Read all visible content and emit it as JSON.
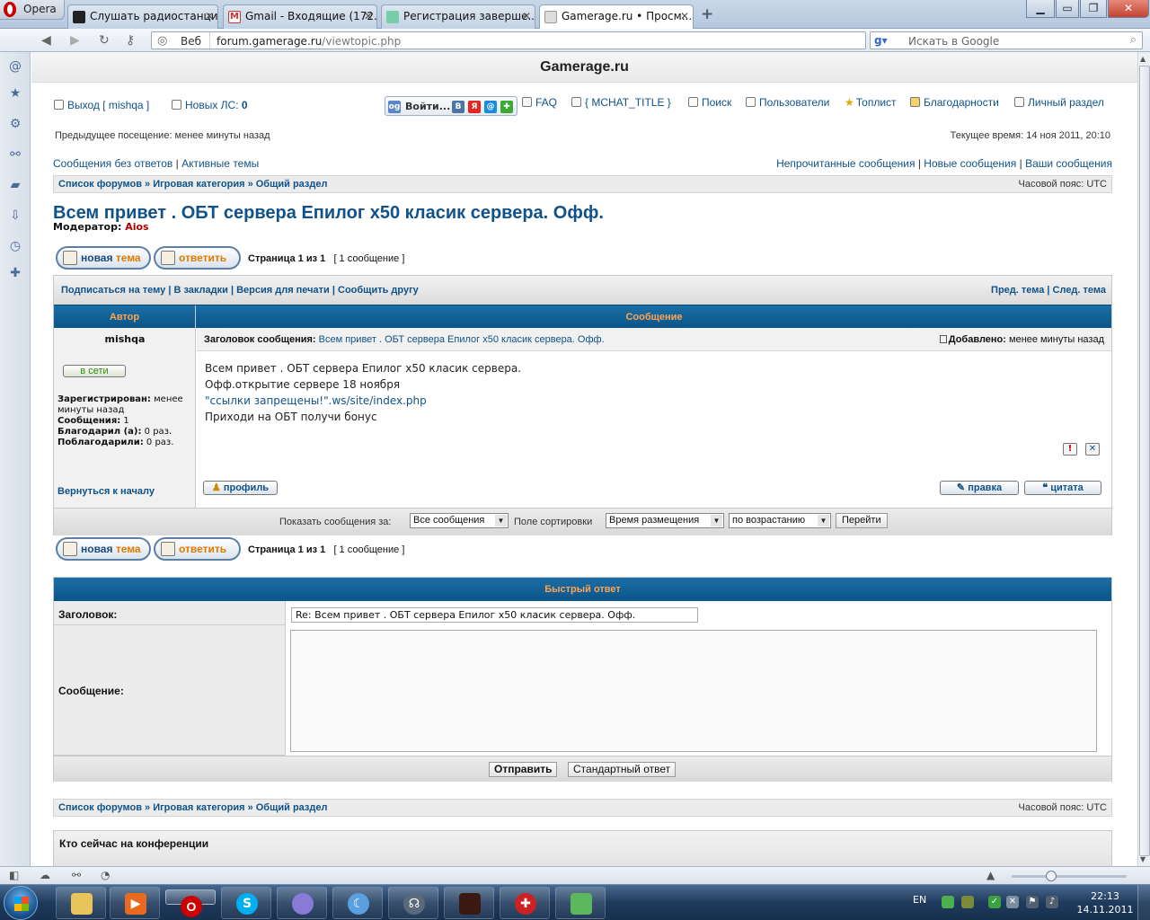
{
  "browser": {
    "opera_label": "Opera",
    "tabs": [
      {
        "label": "Слушать радиостанци..."
      },
      {
        "label": "Gmail - Входящие (172..."
      },
      {
        "label": "Регистрация заверше..."
      },
      {
        "label": "Gamerage.ru • Просм..."
      }
    ],
    "address": {
      "web_label": "Веб",
      "url_host": "forum.gamerage.ru",
      "url_path": "/viewtopic.php"
    },
    "search_placeholder": "Искать в Google"
  },
  "site": {
    "title": "Gamerage.ru"
  },
  "topbar": {
    "logout": "Выход [ mishqa ]",
    "new_pm_label": "Новых ЛС:",
    "new_pm_count": "0",
    "login_box": "Войти...",
    "faq": "FAQ",
    "mchat": "{ MCHAT_TITLE }",
    "search": "Поиск",
    "members": "Пользователи",
    "toplist": "Топлист",
    "thanks": "Благодарности",
    "personal": "Личный раздел",
    "last_visit": "Предыдущее посещение: менее минуты назад",
    "current_time": "Текущее время: 14 ноя 2011, 20:10"
  },
  "links_left": {
    "unanswered": "Сообщения без ответов",
    "sep": "|",
    "active": "Активные темы"
  },
  "links_right": {
    "unread": "Непрочитанные сообщения",
    "new": "Новые сообщения",
    "yours": "Ваши сообщения",
    "sep": "|"
  },
  "breadcrumb": {
    "text": "Список форумов » Игровая категория » Общий раздел",
    "timezone": "Часовой пояс: UTC"
  },
  "topic": {
    "title": "Всем привет . ОБТ сервера Епилог x50 класик сервера. Офф.",
    "moderator_label": "Модератор:",
    "moderator_name": "Aios"
  },
  "buttons": {
    "new_topic_a": "новая ",
    "new_topic_b": "тема",
    "reply": "ответить",
    "page_label": "Страница",
    "page_cur": "1",
    "page_of": "из",
    "page_total": "1",
    "post_count": "[ 1 сообщение ]"
  },
  "options": {
    "left": "Подписаться на тему | В закладки | Версия для печати | Сообщить другу",
    "right": "Пред. тема | След. тема"
  },
  "post_table": {
    "col_author": "Автор",
    "col_message": "Сообщение",
    "author": "mishqa",
    "online": "в сети",
    "registered_label": "Зарегистрирован:",
    "registered_value": "менее минуты назад",
    "posts_label": "Сообщения:",
    "posts_value": "1",
    "thanked_label": "Благодарил (а):",
    "thanked_value": "0 раз.",
    "got_thanks_label": "Поблагодарили:",
    "got_thanks_value": "0 раз.",
    "subject_label": "Заголовок сообщения:",
    "subject_value": "Всем привет . ОБТ сервера Епилог x50 класик сервера. Офф.",
    "added_label": "Добавлено:",
    "added_value": "менее минуты назад",
    "body_line1": "Всем привет . ОБТ сервера Епилог x50 класик сервера.",
    "body_line2": "Офф.открытие сервере 18 ноября",
    "body_link": "\"ссылки запрещены!\".ws/site/index.php",
    "body_line4": "Приходи на ОБТ получи бонус",
    "back_to_top": "Вернуться к началу",
    "profile": "профиль",
    "edit": "правка",
    "quote": "цитата"
  },
  "sort": {
    "show_label": "Показать сообщения за:",
    "show_value": "Все сообщения",
    "sort_label": "Поле сортировки",
    "sort_value": "Время размещения",
    "order_value": "по возрастанию",
    "go": "Перейти"
  },
  "quick_reply": {
    "title": "Быстрый ответ",
    "subject_label": "Заголовок:",
    "subject_value": "Re: Всем привет . ОБТ сервера Епилог x50 класик сервера.  Офф.",
    "message_label": "Сообщение:",
    "submit": "Отправить",
    "standard": "Стандартный ответ"
  },
  "who_online": {
    "title": "Кто сейчас на конференции"
  },
  "tray": {
    "lang": "EN",
    "time": "22:13",
    "date": "14.11.2011"
  }
}
